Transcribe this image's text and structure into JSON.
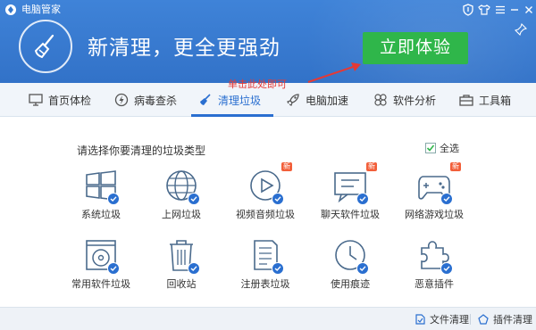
{
  "window": {
    "title": "电脑管家"
  },
  "banner": {
    "slogan": "新清理，更全更强劲",
    "cta_label": "立即体验"
  },
  "annotation": {
    "text": "单击此处即可"
  },
  "nav": {
    "items": [
      {
        "label": "首页体检",
        "icon": "monitor-icon"
      },
      {
        "label": "病毒查杀",
        "icon": "lightning-shield-icon"
      },
      {
        "label": "清理垃圾",
        "icon": "broom-icon",
        "active": true
      },
      {
        "label": "电脑加速",
        "icon": "rocket-icon"
      },
      {
        "label": "软件分析",
        "icon": "clover-icon"
      },
      {
        "label": "工具箱",
        "icon": "toolbox-icon"
      }
    ]
  },
  "content": {
    "section_title": "请选择你要清理的垃圾类型",
    "select_all_label": "全选",
    "select_all_checked": true,
    "new_badge": "新",
    "items": [
      {
        "label": "系统垃圾",
        "icon": "windows-icon"
      },
      {
        "label": "上网垃圾",
        "icon": "globe-icon"
      },
      {
        "label": "视频音频垃圾",
        "icon": "play-icon"
      },
      {
        "label": "聊天软件垃圾",
        "icon": "chat-icon"
      },
      {
        "label": "网络游戏垃圾",
        "icon": "gamepad-icon"
      },
      {
        "label": "常用软件垃圾",
        "icon": "disc-icon"
      },
      {
        "label": "回收站",
        "icon": "trash-icon"
      },
      {
        "label": "注册表垃圾",
        "icon": "registry-icon"
      },
      {
        "label": "使用痕迹",
        "icon": "clock-icon"
      },
      {
        "label": "恶意插件",
        "icon": "puzzle-icon"
      }
    ]
  },
  "footer": {
    "file_clean_label": "文件清理",
    "plugin_clean_label": "插件清理"
  },
  "colors": {
    "banner": "#3577cc",
    "cta": "#2fb64a",
    "accent": "#2a6fd0",
    "icon": "#4a6a8c",
    "badge": "#f25f3a",
    "annotation": "#e53935"
  }
}
